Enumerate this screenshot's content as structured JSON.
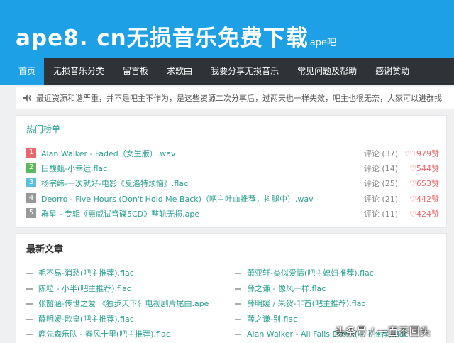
{
  "header": {
    "logo_main": "ape8. cn无损音乐免费下载",
    "logo_sub": "ape吧"
  },
  "nav": {
    "items": [
      {
        "label": "首页"
      },
      {
        "label": "无损音乐分类"
      },
      {
        "label": "留言板"
      },
      {
        "label": "求歌曲"
      },
      {
        "label": "我要分享无损音乐"
      },
      {
        "label": "常见问题及帮助"
      },
      {
        "label": "感谢赞助"
      }
    ]
  },
  "notice": {
    "icon": "speaker-icon",
    "text": "最近资源和谐严重，并不是吧主不作为，是这些资源二次分享后，过两天也一样失效，吧主也很无奈，大家可以进群找"
  },
  "hot": {
    "title": "热门榜单",
    "items": [
      {
        "rank": "1",
        "title": "Alan Walker - Faded（女生版）.wav",
        "comments": "评论 (37)",
        "likes": "♡1979赞",
        "color": "#e8676b"
      },
      {
        "rank": "2",
        "title": "田馥甄-小幸运.flac",
        "comments": "评论 (14)",
        "likes": "♡544赞",
        "color": "#5cb85c"
      },
      {
        "rank": "3",
        "title": "杨宗纬-一次就好-电影《夏洛特烦恼》.flac",
        "comments": "评论 (25)",
        "likes": "♡653赞",
        "color": "#5bc0de"
      },
      {
        "rank": "4",
        "title": "Deorro - Five Hours (Don't Hold Me Back)（吧主吐血推荐，抖腿中）.wav",
        "comments": "评论 (21)",
        "likes": "♡442赞",
        "color": "#999999"
      },
      {
        "rank": "5",
        "title": "群星 - 专辑《惠威试音碟5CD》整轨无损.ape",
        "comments": "评论 (11)",
        "likes": "♡424赞",
        "color": "#999999"
      }
    ]
  },
  "latest": {
    "title": "最新文章",
    "items": [
      {
        "title": "毛不易-消愁(吧主推荐).flac"
      },
      {
        "title": "萧亚轩-类似爱情(吧主媳妇推荐).flac"
      },
      {
        "title": "陈粒 - 小半(吧主推荐).flac"
      },
      {
        "title": "薛之谦 - 像风一样.flac"
      },
      {
        "title": "张韶涵-传世之爱 《独步天下》电视剧片尾曲.ape"
      },
      {
        "title": "薛明媛 / 朱贺-非酋(吧主推荐).flac"
      },
      {
        "title": "薛明媛-欧皇(吧主推荐).flac"
      },
      {
        "title": "薛之谦-别.flac"
      },
      {
        "title": "鹿先森乐队 - 春风十里(吧主推荐).flac"
      },
      {
        "title": "Alan Walker - All Falls Down(吧主推荐).flac"
      }
    ]
  },
  "watermark": "头条号 / 一直不回头"
}
